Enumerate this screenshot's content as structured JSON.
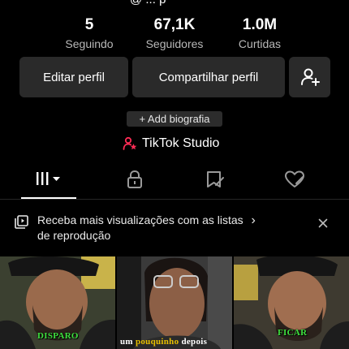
{
  "profile": {
    "handle_partial": "@ ... p"
  },
  "stats": [
    {
      "value": "5",
      "label": "Seguindo"
    },
    {
      "value": "67,1K",
      "label": "Seguidores"
    },
    {
      "value": "1.0M",
      "label": "Curtidas"
    }
  ],
  "buttons": {
    "edit_profile": "Editar perfil",
    "share_profile": "Compartilhar perfil"
  },
  "bio_button": "+ Add biografia",
  "studio_link": "TikTok Studio",
  "tabs": [
    {
      "icon": "grid-icon",
      "active": true
    },
    {
      "icon": "lock-icon",
      "active": false
    },
    {
      "icon": "bookmark-icon",
      "active": false
    },
    {
      "icon": "heart-icon",
      "active": false
    }
  ],
  "playlist_banner": {
    "text_line1": "Receba mais visualizações com as listas",
    "text_line2": "de reprodução",
    "chevron": "›"
  },
  "videos": [
    {
      "caption": "DISPARO",
      "caption_color": "#3ee03e"
    },
    {
      "caption_part1": "um ",
      "caption_highlight": "pouquinho",
      "caption_part2": " depois",
      "highlight_color": "#e8c000"
    },
    {
      "caption": "FICAR",
      "caption_color": "#3ee03e"
    }
  ],
  "colors": {
    "background": "#000000",
    "button": "#2a2a2a",
    "accent_pink": "#fe2c55"
  }
}
